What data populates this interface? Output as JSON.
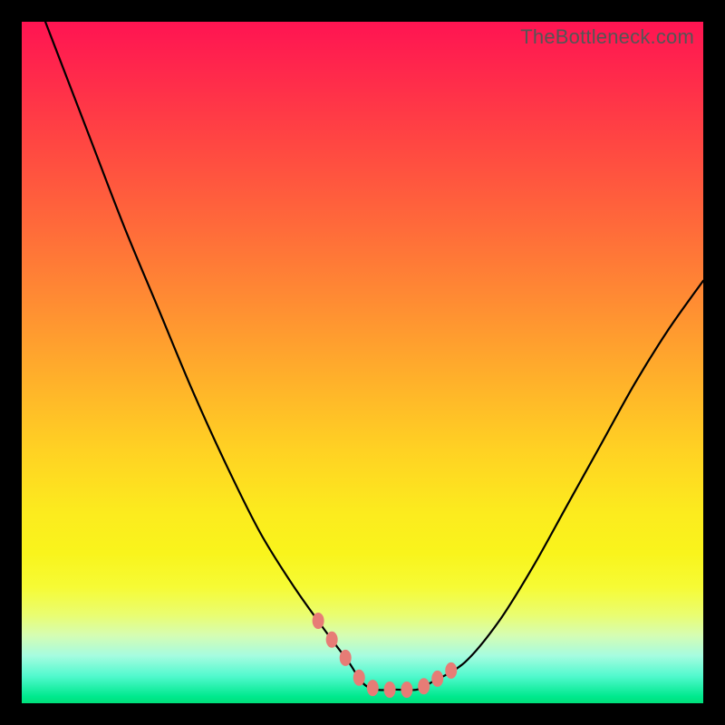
{
  "watermark": "TheBottleneck.com",
  "colors": {
    "frame": "#000000",
    "curve": "#000000",
    "marker": "#E77C76"
  },
  "chart_data": {
    "type": "line",
    "title": "",
    "xlabel": "",
    "ylabel": "",
    "xlim": [
      0,
      100
    ],
    "ylim": [
      0,
      100
    ],
    "x": [
      0,
      5,
      10,
      15,
      20,
      25,
      30,
      35,
      40,
      45,
      48,
      50,
      52,
      55,
      58,
      60,
      65,
      70,
      75,
      80,
      85,
      90,
      95,
      100
    ],
    "values": [
      109,
      96,
      83,
      70,
      58,
      46,
      35,
      25,
      17,
      10,
      6,
      3,
      2,
      2,
      2,
      3,
      6,
      12,
      20,
      29,
      38,
      47,
      55,
      62
    ],
    "series": [
      {
        "name": "bottleneck-curve",
        "x": [
          0,
          5,
          10,
          15,
          20,
          25,
          30,
          35,
          40,
          45,
          48,
          50,
          52,
          55,
          58,
          60,
          65,
          70,
          75,
          80,
          85,
          90,
          95,
          100
        ],
        "y": [
          109,
          96,
          83,
          70,
          58,
          46,
          35,
          25,
          17,
          10,
          6,
          3,
          2,
          2,
          2,
          3,
          6,
          12,
          20,
          29,
          38,
          47,
          55,
          62
        ]
      }
    ],
    "markers_x": [
      43.5,
      45.5,
      47.5,
      49.5,
      51.5,
      54,
      56.5,
      59,
      61,
      63
    ],
    "grid": false,
    "legend": false
  }
}
